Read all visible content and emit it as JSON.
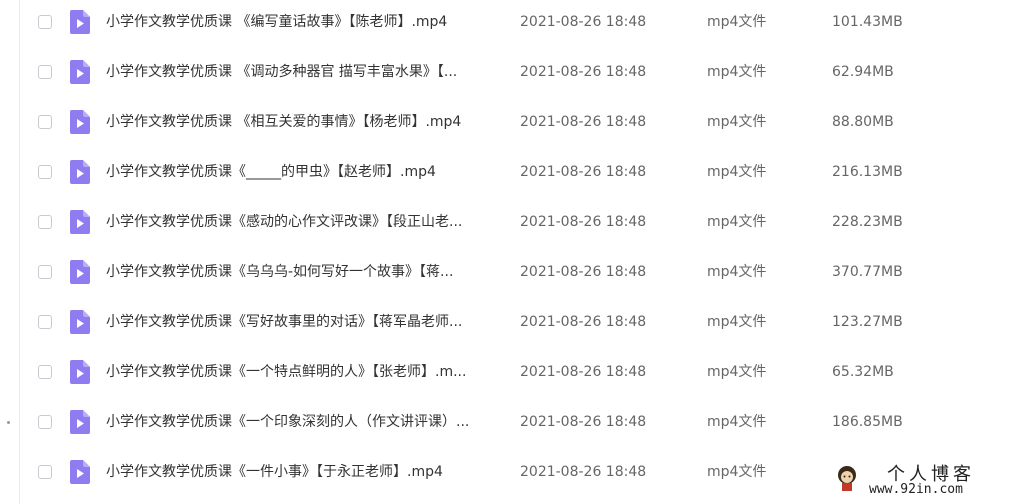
{
  "files": [
    {
      "name": "小学作文教学优质课 《编写童话故事》【陈老师】.mp4",
      "date": "2021-08-26 18:48",
      "type": "mp4文件",
      "size": "101.43MB"
    },
    {
      "name": "小学作文教学优质课 《调动多种器官 描写丰富水果》【...",
      "date": "2021-08-26 18:48",
      "type": "mp4文件",
      "size": "62.94MB"
    },
    {
      "name": "小学作文教学优质课 《相互关爱的事情》【杨老师】.mp4",
      "date": "2021-08-26 18:48",
      "type": "mp4文件",
      "size": "88.80MB"
    },
    {
      "name": "小学作文教学优质课《_____的甲虫》【赵老师】.mp4",
      "date": "2021-08-26 18:48",
      "type": "mp4文件",
      "size": "216.13MB"
    },
    {
      "name": "小学作文教学优质课《感动的心作文评改课》【段正山老...",
      "date": "2021-08-26 18:48",
      "type": "mp4文件",
      "size": "228.23MB"
    },
    {
      "name": "小学作文教学优质课《乌乌乌-如何写好一个故事》【蒋...",
      "date": "2021-08-26 18:48",
      "type": "mp4文件",
      "size": "370.77MB"
    },
    {
      "name": "小学作文教学优质课《写好故事里的对话》【蒋军晶老师...",
      "date": "2021-08-26 18:48",
      "type": "mp4文件",
      "size": "123.27MB"
    },
    {
      "name": "小学作文教学优质课《一个特点鲜明的人》【张老师】.m...",
      "date": "2021-08-26 18:48",
      "type": "mp4文件",
      "size": "65.32MB"
    },
    {
      "name": "小学作文教学优质课《一个印象深刻的人（作文讲评课）...",
      "date": "2021-08-26 18:48",
      "type": "mp4文件",
      "size": "186.85MB"
    },
    {
      "name": "小学作文教学优质课《一件小事》【于永正老师】.mp4",
      "date": "2021-08-26 18:48",
      "type": "mp4文件",
      "size": ""
    }
  ],
  "icons": {
    "file_icon": "video-file-icon",
    "checkbox": "checkbox-icon"
  },
  "colors": {
    "video_icon": "#8e7cf0",
    "video_icon_fold": "#b8acf7"
  },
  "watermark": {
    "title": "个人博客",
    "url": "www.92in.com"
  }
}
